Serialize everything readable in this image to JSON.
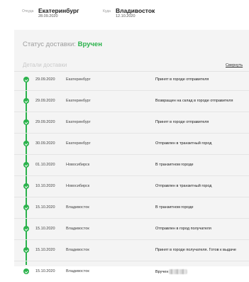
{
  "route": {
    "from_label": "Откуда",
    "from_city": "Екатеринбург",
    "from_date": "28.09.2020",
    "to_label": "Куда",
    "to_city": "Владивосток",
    "to_date": "12.10.2020"
  },
  "status": {
    "label": "Статус доставки:",
    "value": "Вручен"
  },
  "details": {
    "title": "Детали доставки",
    "collapse_label": "Свернуть"
  },
  "events": [
    {
      "date": "29.09.2020",
      "place": "Екатеринбург",
      "event": "Принят в городе отправителя"
    },
    {
      "date": "29.09.2020",
      "place": "Екатеринбург",
      "event": "Возвращен на склад в городе отправителя"
    },
    {
      "date": "29.09.2020",
      "place": "Екатеринбург",
      "event": "Принят в городе отправителя"
    },
    {
      "date": "30.09.2020",
      "place": "Екатеринбург",
      "event": "Отправлен в транзитный город"
    },
    {
      "date": "01.10.2020",
      "place": "Новосибирск",
      "event": "В транзитном городе"
    },
    {
      "date": "10.10.2020",
      "place": "Новосибирск",
      "event": "Отправлен в транзитный город"
    },
    {
      "date": "15.10.2020",
      "place": "Владивосток",
      "event": "В транзитном городе"
    },
    {
      "date": "15.10.2020",
      "place": "Владивосток",
      "event": "Отправлен в город получателя"
    },
    {
      "date": "15.10.2020",
      "place": "Владивосток",
      "event": "Принят в городе получателя. Готов к выдаче"
    },
    {
      "date": "15.10.2020",
      "place": "Владивосток",
      "event": "Вручен"
    }
  ],
  "colors": {
    "accent": "#2bb24c"
  },
  "icons": {
    "step": "check-circle-icon"
  }
}
